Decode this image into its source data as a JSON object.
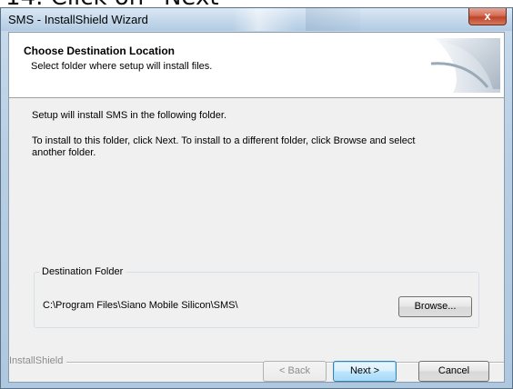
{
  "caption": "14. Click on “Next”",
  "window": {
    "title": "SMS - InstallShield Wizard",
    "close_glyph": "x"
  },
  "header": {
    "title": "Choose Destination Location",
    "subtitle": "Select folder where setup will install files."
  },
  "body": {
    "line1": "Setup will install SMS in the following folder.",
    "line2": "To install to this folder, click Next. To install to a different folder, click Browse and select",
    "line3": "another folder."
  },
  "destination": {
    "label": "Destination Folder",
    "path": "C:\\Program Files\\Siano Mobile Silicon\\SMS\\",
    "browse_label": "Browse..."
  },
  "brand": "InstallShield",
  "footer": {
    "back_label": "< Back",
    "next_label": "Next >",
    "cancel_label": "Cancel"
  },
  "colors": {
    "title_bar": "#c3d7ea",
    "close_button": "#c0432a",
    "default_button_border": "#3c7fb1"
  },
  "icons": {
    "close": "close-icon",
    "header_art": "installshield-swoosh-graphic"
  }
}
